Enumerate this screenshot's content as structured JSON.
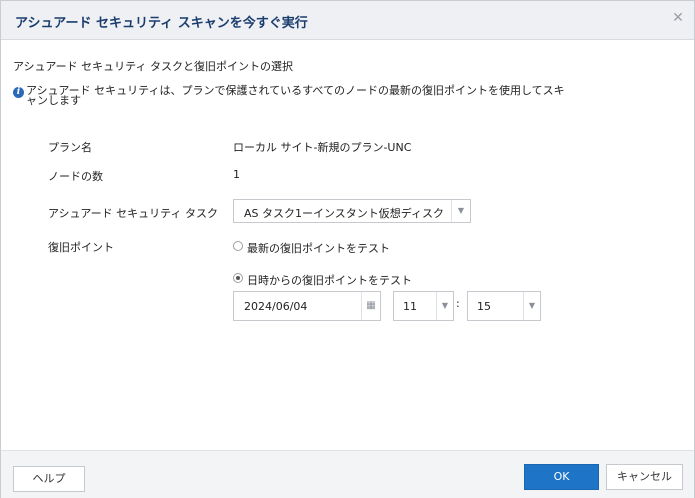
{
  "dialog": {
    "title": "アシュアード セキュリティ スキャンを今すぐ実行",
    "close_glyph": "✕"
  },
  "section": {
    "header": "アシュアード セキュリティ タスクと復旧ポイントの選択",
    "info_text": "アシュアード セキュリティは、プランで保護されているすべてのノードの最新の復旧ポイントを使用してスキャンします"
  },
  "fields": {
    "plan_name_label": "プラン名",
    "plan_name_value": "ローカル サイト-新規のプラン-UNC",
    "node_count_label": "ノードの数",
    "node_count_value": "1",
    "task_label": "アシュアード セキュリティ タスク",
    "task_value": "AS タスク1ーインスタント仮想ディスク",
    "recovery_point_label": "復旧ポイント",
    "radio_latest_label": "最新の復旧ポイントをテスト",
    "radio_datetime_label": "日時からの復旧ポイントをテスト",
    "radio_latest_checked": false,
    "radio_datetime_checked": true,
    "date_value": "2024/06/04",
    "hour_value": "11",
    "minute_value": "15",
    "time_separator": ":"
  },
  "footer": {
    "help_label": "ヘルプ",
    "ok_label": "OK",
    "cancel_label": "キャンセル"
  },
  "colors": {
    "title_text": "#1b3d6e",
    "ok_button": "#1e74c6",
    "info_icon": "#2a6ab8"
  }
}
